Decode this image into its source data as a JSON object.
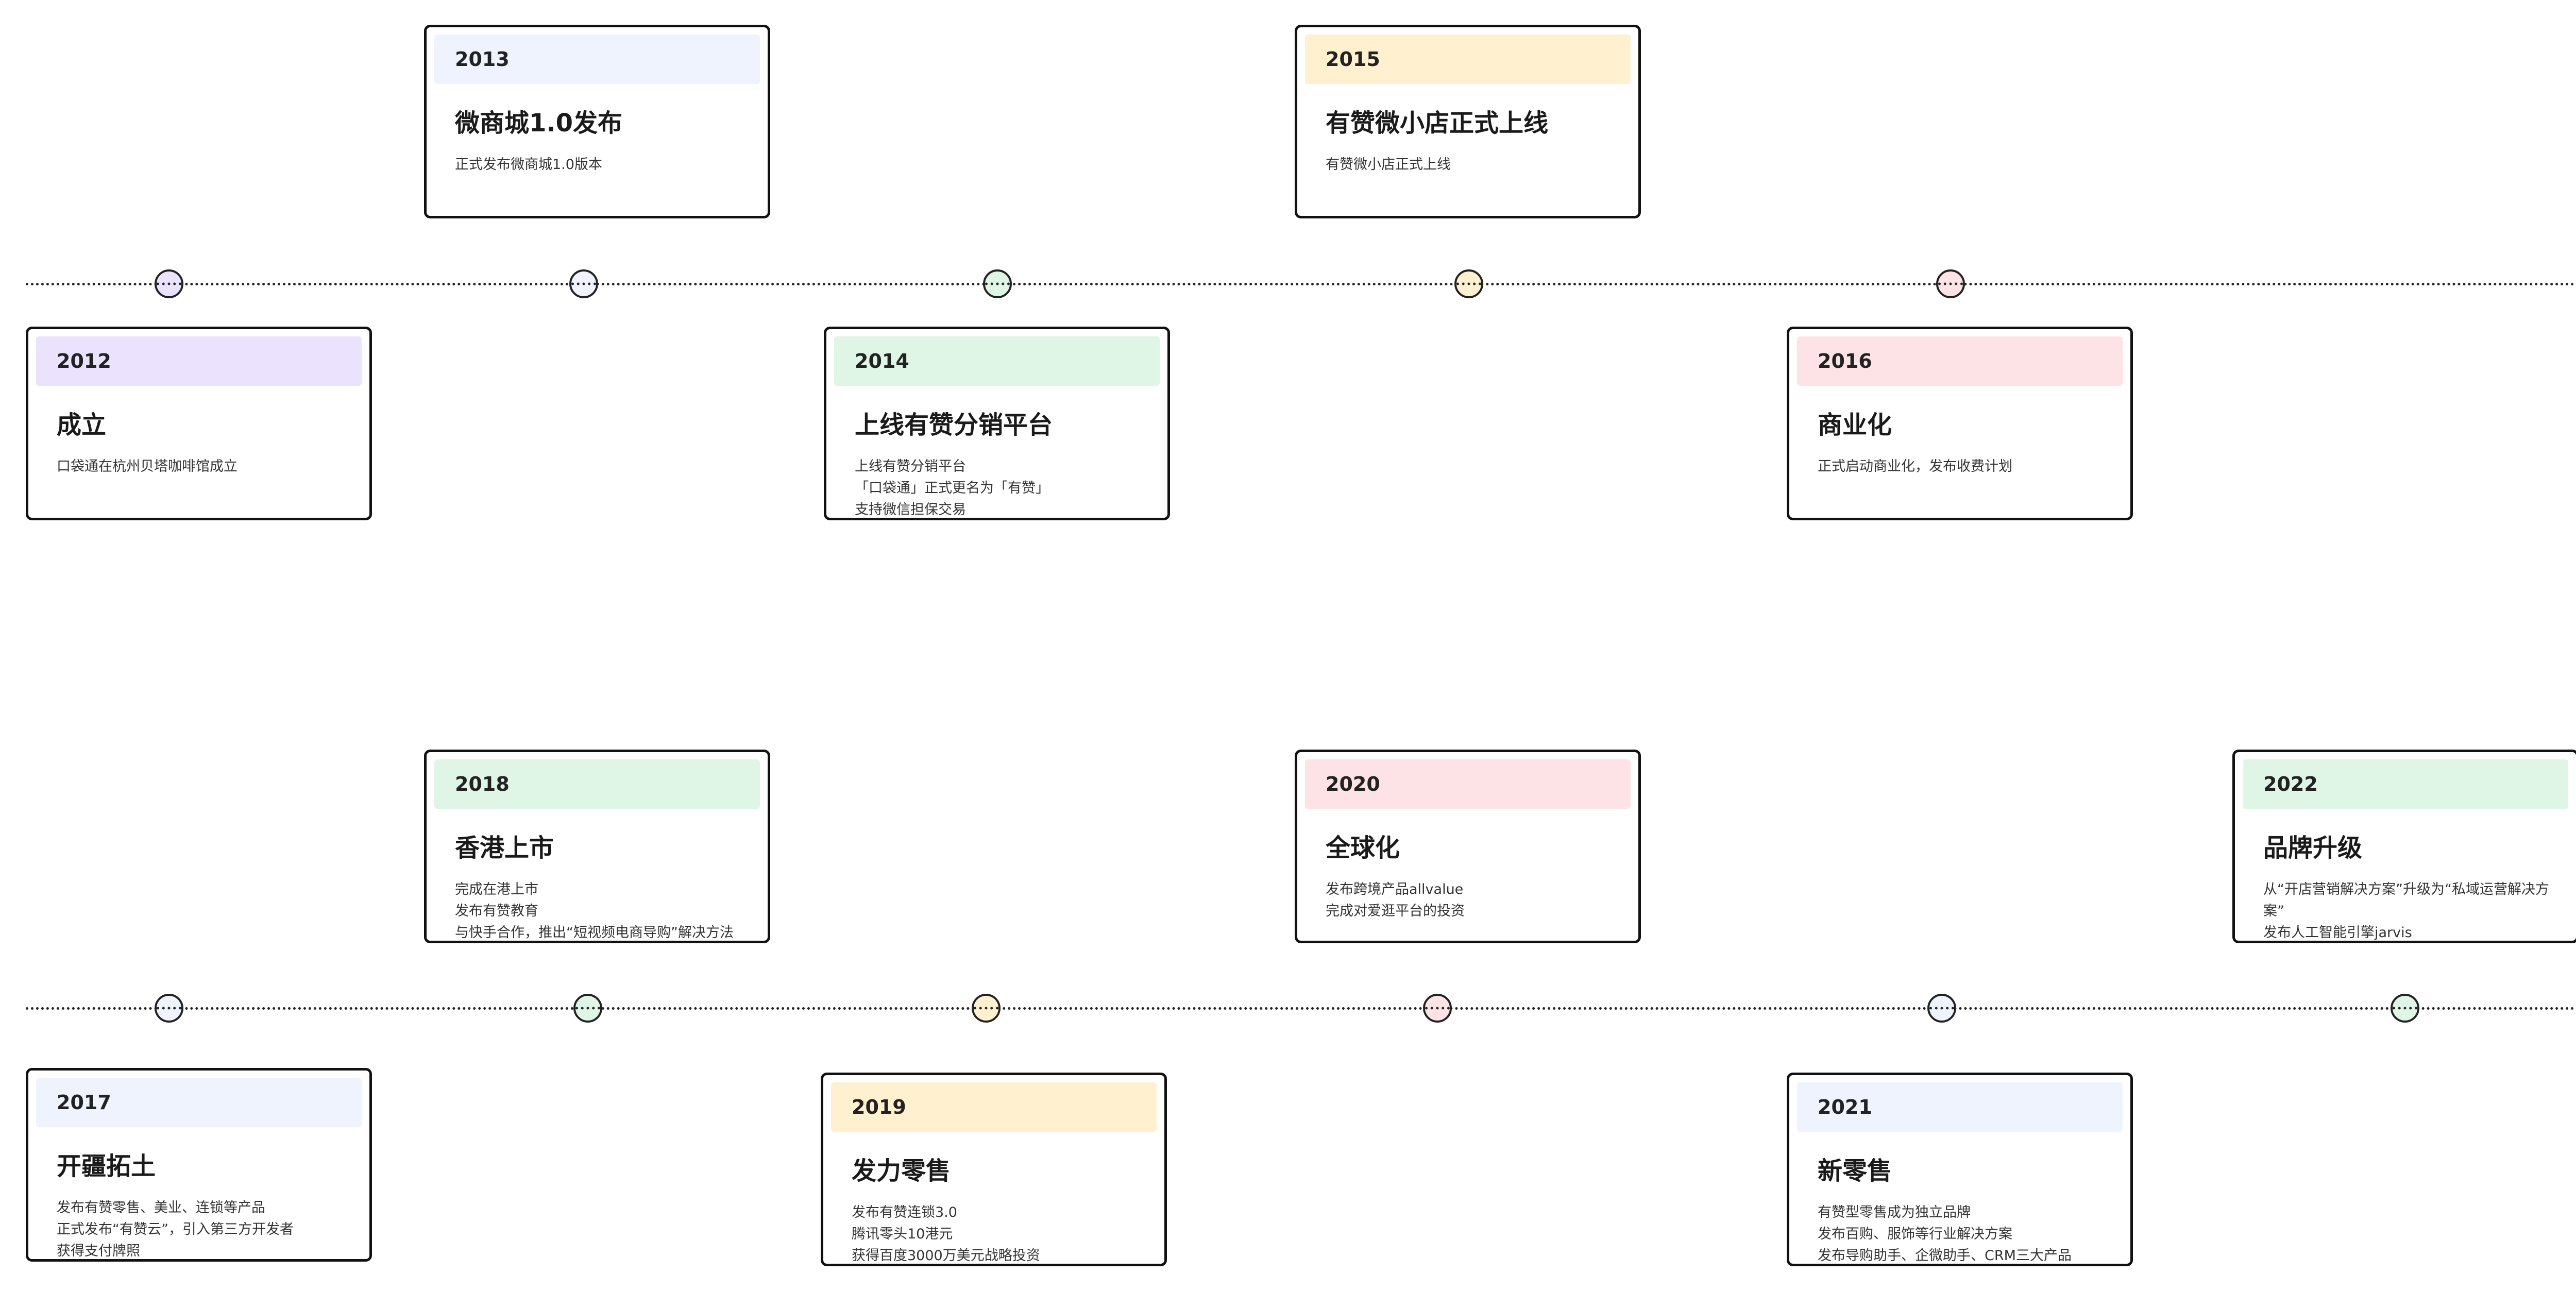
{
  "colors": {
    "purple": "#ebe3fd",
    "blue": "#eef3fd",
    "green": "#dff5e6",
    "yellow": "#fff1cf",
    "pink": "#fde3e5"
  },
  "events": [
    {
      "year": "2012",
      "title": "成立",
      "lines": [
        "口袋通在杭州贝塔咖啡馆成立"
      ],
      "color": "#ebe3fd"
    },
    {
      "year": "2013",
      "title": "微商城1.0发布",
      "lines": [
        "正式发布微商城1.0版本"
      ],
      "color": "#eef3fd"
    },
    {
      "year": "2014",
      "title": "上线有赞分销平台",
      "lines": [
        "上线有赞分销平台",
        "「口袋通」正式更名为「有赞」",
        "支持微信担保交易"
      ],
      "color": "#dff5e6"
    },
    {
      "year": "2015",
      "title": "有赞微小店正式上线",
      "lines": [
        "有赞微小店正式上线"
      ],
      "color": "#fff1cf"
    },
    {
      "year": "2016",
      "title": "商业化",
      "lines": [
        "正式启动商业化，发布收费计划"
      ],
      "color": "#fde3e5"
    },
    {
      "year": "2017",
      "title": "开疆拓土",
      "lines": [
        "发布有赞零售、美业、连锁等产品",
        "正式发布“有赞云”，引入第三方开发者",
        "获得支付牌照"
      ],
      "color": "#eef3fd"
    },
    {
      "year": "2018",
      "title": "香港上市",
      "lines": [
        "完成在港上市",
        "发布有赞教育",
        "与快手合作，推出“短视频电商导购”解决方法"
      ],
      "color": "#dff5e6"
    },
    {
      "year": "2019",
      "title": "发力零售",
      "lines": [
        "发布有赞连锁3.0",
        "腾讯零头10港元",
        "获得百度3000万美元战略投资"
      ],
      "color": "#fff1cf"
    },
    {
      "year": "2020",
      "title": "全球化",
      "lines": [
        "发布跨境产品allvalue",
        "完成对爱逛平台的投资"
      ],
      "color": "#fde3e5"
    },
    {
      "year": "2021",
      "title": "新零售",
      "lines": [
        "有赞型零售成为独立品牌",
        "发布百购、服饰等行业解决方案",
        "发布导购助手、企微助手、CRM三大产品"
      ],
      "color": "#eef3fd"
    },
    {
      "year": "2022",
      "title": "品牌升级",
      "lines": [
        "从“开店营销解决方案”升级为“私域运营解决方案”",
        "发布人工智能引擎jarvis"
      ],
      "color": "#dff5e6"
    }
  ],
  "dots": {
    "row1": [
      "#ebe3fd",
      "#eef3fd",
      "#dff5e6",
      "#fff1cf",
      "#fde3e5"
    ],
    "row2": [
      "#eef3fd",
      "#dff5e6",
      "#fff1cf",
      "#fde3e5",
      "#eef3fd",
      "#dff5e6"
    ]
  }
}
